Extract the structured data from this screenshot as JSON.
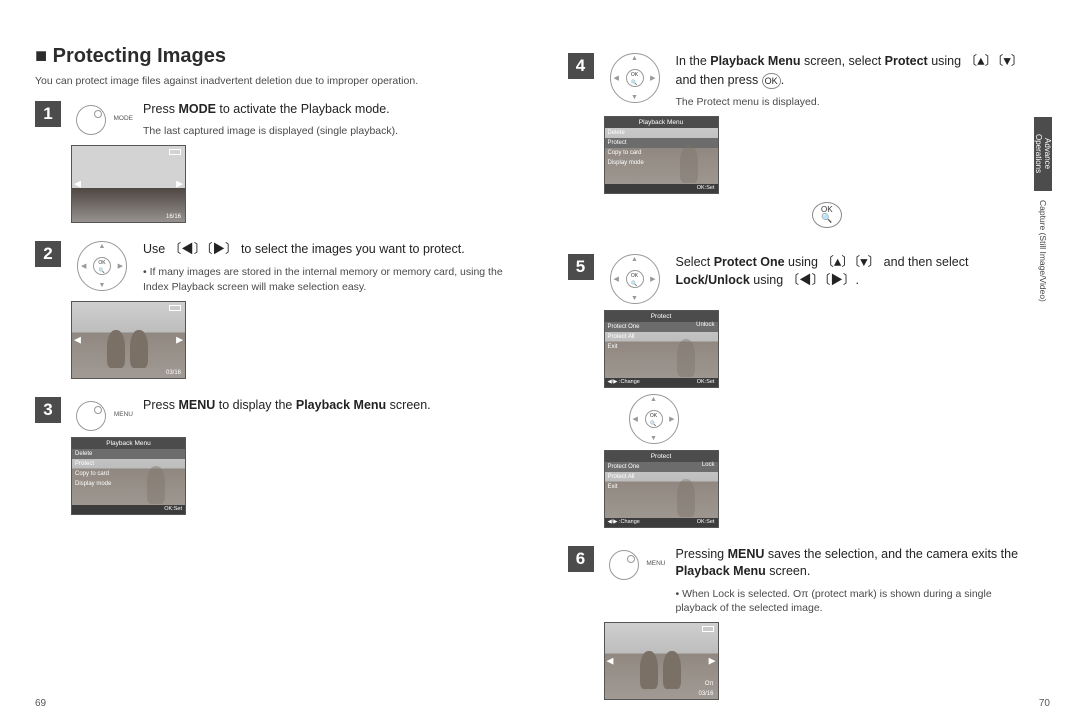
{
  "title": "Protecting Images",
  "intro": "You can protect image files against inadvertent deletion due to improper operation.",
  "side_tab": "Advance Operations",
  "side_label": "Capture (Still Image/Video)",
  "page_left": "69",
  "page_right": "70",
  "ok_label": "OK",
  "mag_label": "🔍",
  "steps": {
    "s1": {
      "num": "1",
      "mode_label": "MODE",
      "instruction_pre": "Press ",
      "instruction_b1": "MODE",
      "instruction_post": " to activate the Playback mode.",
      "note": "The last captured image is displayed (single playback).",
      "lcd_counter": "16/16"
    },
    "s2": {
      "num": "2",
      "instruction_pre": "Use ",
      "instruction_keys": "〔◀〕〔▶〕",
      "instruction_post": " to select the images you want to protect.",
      "note": "If many images are stored in the internal memory or memory card, using the Index Playback screen will make selection easy.",
      "lcd_counter": "03/16"
    },
    "s3": {
      "num": "3",
      "mode_label": "MENU",
      "instruction_pre": "Press ",
      "instruction_b1": "MENU",
      "instruction_mid": " to display the ",
      "instruction_b2": "Playback Menu",
      "instruction_post": " screen.",
      "lcd": {
        "title": "Playback Menu",
        "r1": "Delete",
        "r2": "Protect",
        "r3": "Copy to card",
        "r4": "Display mode",
        "footer_r": "OK:Set"
      }
    },
    "s4": {
      "num": "4",
      "instruction_pre": "In the ",
      "instruction_b1": "Playback Menu",
      "instruction_mid1": " screen, select ",
      "instruction_b2": "Protect",
      "instruction_mid2": " using ",
      "instruction_keys": "〔▲〕〔▼〕",
      "instruction_mid3": " and then press ",
      "instruction_btn": "OK",
      "instruction_post": ".",
      "note": "The Protect menu is displayed.",
      "lcd": {
        "title": "Playback Menu",
        "r1": "Delete",
        "r2": "Protect",
        "r3": "Copy to card",
        "r4": "Display mode",
        "footer_r": "OK:Set"
      }
    },
    "s5": {
      "num": "5",
      "instruction_pre": "Select ",
      "instruction_b1": "Protect One",
      "instruction_mid1": " using ",
      "instruction_keys1": "〔▲〕〔▼〕",
      "instruction_mid2": " and then select ",
      "instruction_b2": "Lock/Unlock",
      "instruction_mid3": " using ",
      "instruction_keys2": "〔◀〕〔▶〕",
      "instruction_post": ".",
      "lcd1": {
        "title": "Protect",
        "r1": "Protect One",
        "r1r": "Unlock",
        "r2": "Protect All",
        "r3": "Exit",
        "footer_l": "◀/▶ :Change",
        "footer_r": "OK:Set"
      },
      "lcd2": {
        "title": "Protect",
        "r1": "Protect One",
        "r1r": "Lock",
        "r2": "Protect All",
        "r3": "Exit",
        "footer_l": "◀/▶ :Change",
        "footer_r": "OK:Set"
      }
    },
    "s6": {
      "num": "6",
      "mode_label": "MENU",
      "instruction_pre": "Pressing ",
      "instruction_b1": "MENU",
      "instruction_mid1": " saves the selection, and the camera exits the ",
      "instruction_b2": "Playback Menu",
      "instruction_post": " screen.",
      "note_pre": "When ",
      "note_b": "Lock",
      "note_mid": " is selected. ",
      "note_icon": "Oπ",
      "note_post": " (protect mark) is shown during a single playback of the selected image.",
      "lcd_counter": "03/16",
      "lcd_mark": "Oπ"
    }
  }
}
